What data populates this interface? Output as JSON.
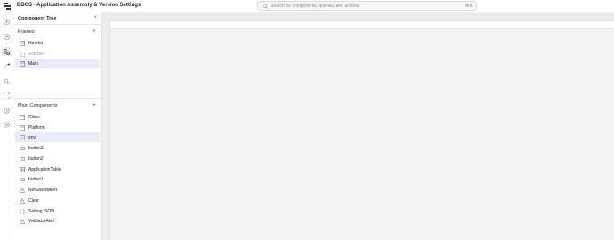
{
  "app": {
    "title": "BBCS - Application Assembly & Version Settings"
  },
  "search": {
    "placeholder": "Search for components, queries, and actions",
    "shortcut": "⌘K"
  },
  "rail": {
    "icons": [
      "add-icon",
      "database-icon",
      "component-tree-icon",
      "workflow-icon",
      "search-icon",
      "layout-icon",
      "history-icon",
      "settings-icon"
    ]
  },
  "panel": {
    "title": "Component Tree",
    "close": "×",
    "frames_label": "Frames",
    "add": "+",
    "frames": [
      {
        "label": "Header",
        "icon": "frame-icon"
      },
      {
        "label": "Sidebar",
        "icon": "frame-icon"
      },
      {
        "label": "Main",
        "icon": "frame-icon"
      }
    ],
    "main_components_label": "Main Components",
    "components": [
      {
        "label": "Client",
        "icon": "container-icon"
      },
      {
        "label": "Platform",
        "icon": "container-icon"
      },
      {
        "label": "env",
        "icon": "select-icon"
      },
      {
        "label": "button3",
        "icon": "button-icon"
      },
      {
        "label": "button2",
        "icon": "button-icon"
      },
      {
        "label": "ApplicationTable",
        "icon": "table-icon"
      },
      {
        "label": "button1",
        "icon": "button-icon"
      },
      {
        "label": "NotSavedAlert",
        "icon": "alert-icon"
      },
      {
        "label": "Clear",
        "icon": "alert-icon"
      },
      {
        "label": "SettingJSON",
        "icon": "json-icon"
      },
      {
        "label": "ValidatorAlert",
        "icon": "alert-icon"
      }
    ]
  },
  "colors": {
    "selected": "#e7ecf7",
    "rail_active": "#e6e9f2",
    "canvas_bg": "#ececec"
  }
}
